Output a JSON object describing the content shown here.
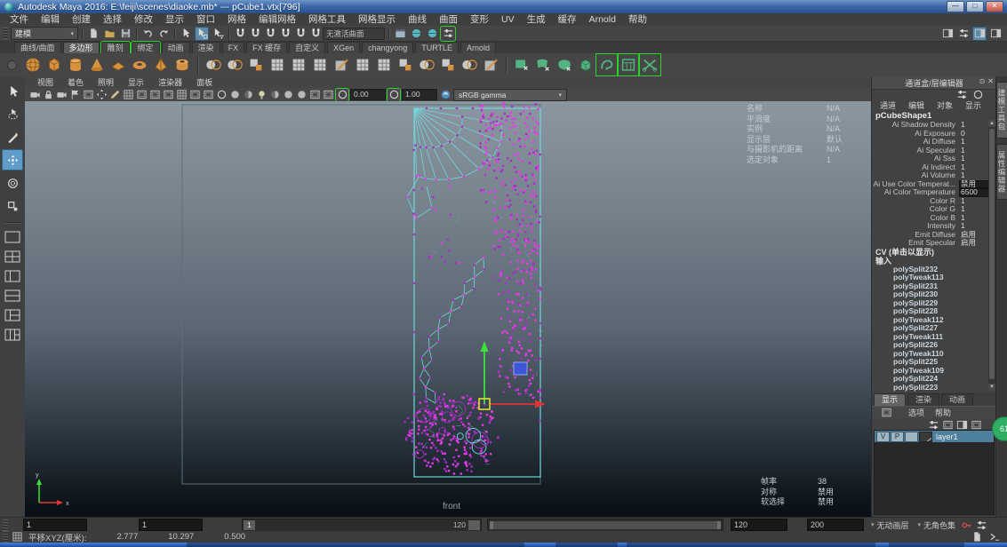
{
  "window": {
    "title": "Autodesk Maya 2016: E:\\feiji\\scenes\\diaoke.mb*  ---  pCube1.vtx[796]",
    "minimize": "—",
    "maximize": "□",
    "close": "✕"
  },
  "menus": [
    "文件",
    "编辑",
    "创建",
    "选择",
    "修改",
    "显示",
    "窗口",
    "网格",
    "编辑网格",
    "网格工具",
    "网格显示",
    "曲线",
    "曲面",
    "变形",
    "UV",
    "生成",
    "缓存",
    "Arnold",
    "帮助"
  ],
  "statusline": {
    "mode": "建模",
    "no_active_surface": "无激活曲面",
    "file_icons": [
      "new-scene",
      "open-scene",
      "save-scene"
    ],
    "undo_icons": [
      "undo",
      "redo"
    ],
    "mask_icons": [
      "select-hierarchy",
      {
        "name": "select-object",
        "active": true
      },
      "select-component"
    ],
    "snap_icons": [
      "snap-to-grid",
      "snap-to-curve",
      "snap-to-point",
      "snap-to-projected-center",
      "snap-to-view-plane",
      "make-live"
    ],
    "render_icons": [
      "render-view",
      "render-current-frame",
      "ipr-render",
      {
        "name": "render-settings",
        "bracket": true
      }
    ],
    "sidebar_icons": [
      "attribute-editor",
      "tool-settings",
      {
        "name": "channel-box",
        "active": true
      },
      "modeling-toolkit"
    ]
  },
  "shelf": {
    "tabs": [
      {
        "label": "曲线/曲面"
      },
      {
        "label": "多边形",
        "active": true
      },
      {
        "label": "雕刻",
        "bracket": true
      },
      {
        "label": "绑定",
        "bracket": true
      },
      {
        "label": "动画"
      },
      {
        "label": "渲染"
      },
      {
        "label": "FX"
      },
      {
        "label": "FX 缓存"
      },
      {
        "label": "自定义"
      },
      {
        "label": "XGen"
      },
      {
        "label": "changyong"
      },
      {
        "label": "TURTLE"
      },
      {
        "label": "Arnold"
      }
    ],
    "poly_icons": [
      "poly-sphere",
      "poly-cube",
      "poly-cylinder",
      "poly-cone",
      "poly-plane",
      "poly-torus",
      "poly-pyramid",
      "poly-pipe"
    ],
    "edit_icons": [
      "boolean-union",
      "combine",
      "extract",
      "smooth",
      "triangulate",
      "quadrangulate",
      "multi-cut",
      "insert-edge-loop",
      "offset-edge-loop",
      "bevel",
      "bridge",
      "extrude",
      "mirror-geometry",
      "reduce"
    ],
    "green_icons": [
      "quad-draw-plane",
      "bend-surface",
      "sculpt-blob",
      "sculpt-cube",
      {
        "name": "curve-warp",
        "bracket": true
      },
      {
        "name": "uv-texture-window",
        "bracket": true
      },
      {
        "name": "cut-geometry",
        "bracket": true
      }
    ]
  },
  "toolbox": {
    "tools": [
      {
        "name": "select-tool"
      },
      {
        "name": "lasso-select-tool"
      },
      {
        "name": "paint-select-tool"
      },
      {
        "name": "move-tool",
        "active": true
      },
      {
        "name": "rotate-tool"
      },
      {
        "name": "scale-tool"
      }
    ],
    "layouts": [
      "layout-single",
      "layout-four-pane",
      "layout-split-lr",
      "layout-split-tb",
      "layout-three-pane",
      "layout-custom"
    ]
  },
  "panel_menus": [
    "视图",
    "着色",
    "照明",
    "显示",
    "渲染器",
    "面板"
  ],
  "panel_toolbar": {
    "icons": [
      "select-camera",
      "lock-camera",
      "camera-attributes",
      "bookmarks",
      "image-plane",
      "2d-pan-zoom",
      "grease-pencil",
      "grid",
      "film-gate",
      "resolution-gate",
      "gate-mask",
      "field-chart",
      "safe-action",
      "safe-title",
      "wireframe-mode",
      "shaded-mode",
      "textured-mode",
      "use-all-lights",
      "shadows",
      "ambient-occlusion",
      "motion-blur",
      "isolate-select",
      "x-ray"
    ],
    "exposure": "0.00",
    "gamma": "1.00",
    "colorspace": "sRGB gamma"
  },
  "viewport": {
    "camera_label": "front",
    "hud_top": [
      {
        "label": "名称",
        "value": "N/A"
      },
      {
        "label": "平滑度",
        "value": "N/A"
      },
      {
        "label": "实例",
        "value": "N/A"
      },
      {
        "label": "显示层",
        "value": "默认"
      },
      {
        "label": "与摄影机的距离",
        "value": "N/A"
      },
      {
        "label": "选定对象",
        "value": "1"
      }
    ],
    "hud_bottom": [
      {
        "label": "帧率",
        "value": "38"
      },
      {
        "label": "对称",
        "value": "禁用"
      },
      {
        "label": "软选择",
        "value": "禁用"
      }
    ],
    "colors": {
      "wire": "#6fd8dc",
      "vertex": "#e838e8",
      "vertex_dim": "#a82cc8",
      "outer_frame": "#5f6e78",
      "manip_x": "#e23535",
      "manip_y": "#3ce23c",
      "manip_center": "#e8e836",
      "blue_marker": "#3d55d8"
    }
  },
  "channel_box": {
    "title": "通道盒/层编辑器",
    "mini_icons": [
      "channel-slowmode",
      "channel-hyperbolic"
    ],
    "pin": "⊙",
    "close": "✕",
    "menus": [
      "通道",
      "编辑",
      "对象",
      "显示"
    ],
    "node": "pCubeShape1",
    "attributes": [
      {
        "label": "Ai Shadow Density",
        "value": "1"
      },
      {
        "label": "Ai Exposure",
        "value": "0"
      },
      {
        "label": "Ai Diffuse",
        "value": "1"
      },
      {
        "label": "Ai Specular",
        "value": "1"
      },
      {
        "label": "Ai Sss",
        "value": "1"
      },
      {
        "label": "Ai Indirect",
        "value": "1"
      },
      {
        "label": "Ai Volume",
        "value": "1"
      },
      {
        "label": "Ai Use Color Temperat...",
        "value": "禁用",
        "box": true
      },
      {
        "label": "Ai Color Temperature",
        "value": "6500",
        "box": true
      },
      {
        "label": "Color R",
        "value": "1"
      },
      {
        "label": "Color G",
        "value": "1"
      },
      {
        "label": "Color B",
        "value": "1"
      },
      {
        "label": "Intensity",
        "value": "1"
      },
      {
        "label": "Emit Diffuse",
        "value": "启用"
      },
      {
        "label": "Emit Specular",
        "value": "启用"
      }
    ],
    "cv_label": "CV (单击以显示)",
    "inputs_label": "输入",
    "inputs": [
      "polySplit232",
      "polyTweak113",
      "polySplit231",
      "polySplit230",
      "polySplit229",
      "polySplit228",
      "polyTweak112",
      "polySplit227",
      "polyTweak111",
      "polySplit226",
      "polyTweak110",
      "polySplit225",
      "polyTweak109",
      "polySplit224",
      "polySplit223"
    ],
    "scroll_up": "▲",
    "scroll_down": "▼"
  },
  "layer_editor": {
    "tabs": [
      {
        "label": "显示",
        "active": true
      },
      {
        "label": "渲染"
      },
      {
        "label": "动画"
      }
    ],
    "menu": [
      "选项",
      "帮助"
    ],
    "icons": [
      "layer-options",
      "create-empty-layer",
      "create-layer-from-selected",
      "create-override-layer"
    ],
    "layer": {
      "v": "V",
      "p": "P",
      "dt": "",
      "name": "layer1"
    }
  },
  "side_tabs": [
    {
      "label": "建模工具包",
      "active": true
    },
    {
      "label": "属性编辑器"
    }
  ],
  "timeline": {
    "anim_start": "1",
    "playback_start": "1",
    "current": "1",
    "time_end": "120",
    "playback_end": "120",
    "anim_end": "200",
    "anim_layer": "无动画层",
    "char_set": "无角色集",
    "icons": [
      "auto-keyframe",
      "animation-preferences"
    ]
  },
  "helpline": {
    "label": "平移XYZ(厘米):",
    "x": "2.777",
    "y": "10.297",
    "z": "0.500",
    "icons": [
      "script-editor",
      "command-shell"
    ]
  },
  "badge": {
    "text": "61"
  }
}
